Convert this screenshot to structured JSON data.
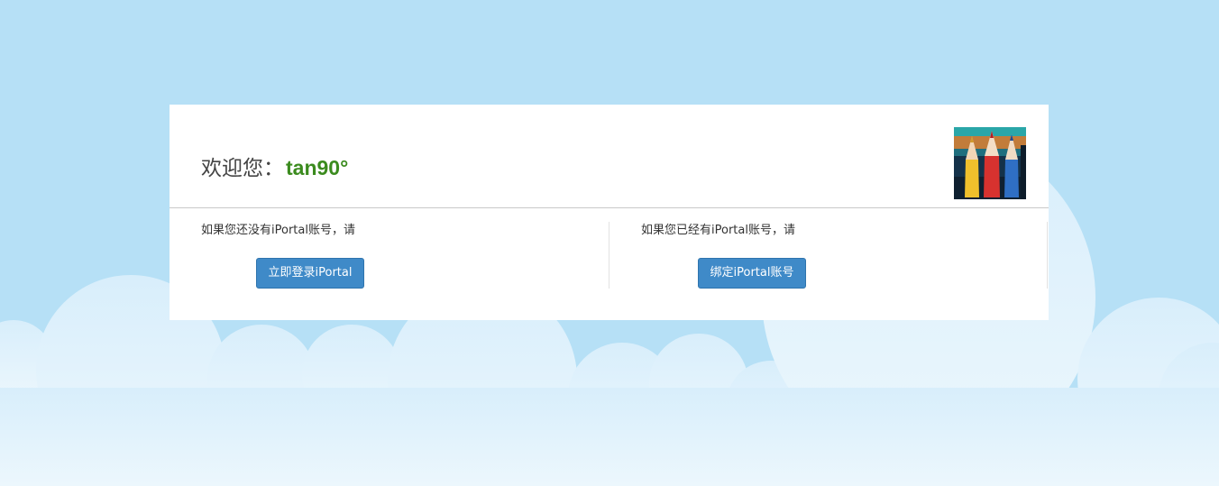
{
  "welcome": {
    "label": "欢迎您",
    "separator": "：",
    "username": "tan90°"
  },
  "avatar": {
    "icon": "colored-pencils-avatar"
  },
  "left_panel": {
    "hint": "如果您还没有iPortal账号，请",
    "button_label": "立即登录iPortal"
  },
  "right_panel": {
    "hint": "如果您已经有iPortal账号，请",
    "button_label": "绑定iPortal账号"
  },
  "colors": {
    "sky": "#b6e0f6",
    "cloud": "#dcf0fb",
    "username": "#3b8b1e",
    "button": "#3f8ac8"
  }
}
